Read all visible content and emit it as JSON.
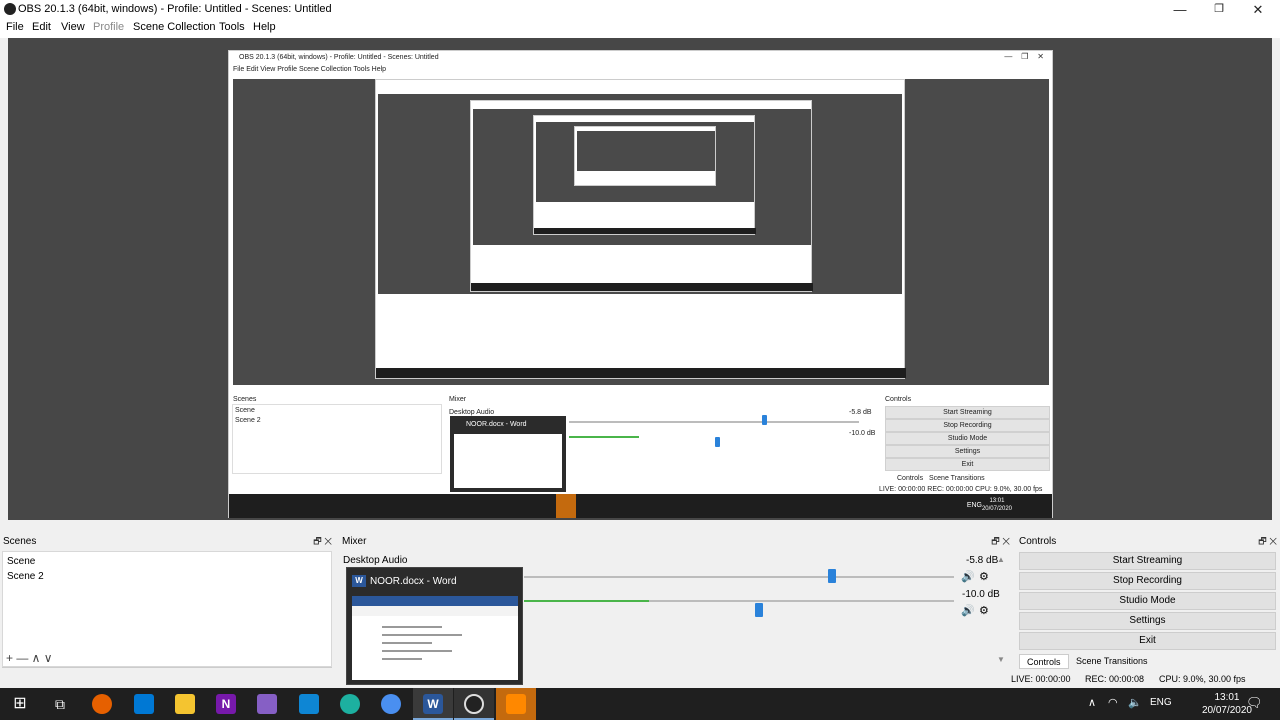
{
  "window": {
    "title": "OBS 20.1.3 (64bit, windows) - Profile: Untitled - Scenes: Untitled",
    "controls": [
      "—",
      "❐",
      "✕"
    ]
  },
  "menu": [
    {
      "label": "File",
      "disabled": false
    },
    {
      "label": "Edit",
      "disabled": false
    },
    {
      "label": "View",
      "disabled": false
    },
    {
      "label": "Profile",
      "disabled": true
    },
    {
      "label": "Scene Collection",
      "disabled": false
    },
    {
      "label": "Tools",
      "disabled": false
    },
    {
      "label": "Help",
      "disabled": false
    }
  ],
  "nested_preview": {
    "title": "OBS 20.1.3 (64bit, windows) - Profile: Untitled - Scenes: Untitled",
    "menu": "File  Edit  View  Profile  Scene Collection  Tools  Help",
    "scenes_header": "Scenes",
    "mixer_header": "Mixer",
    "controls_header": "Controls",
    "scene_1": "Scene",
    "scene_2": "Scene 2",
    "audio_label": "Desktop Audio",
    "db_1": "-5.8 dB",
    "db_2": "-10.0 dB",
    "popup_title": "NOOR.docx - Word",
    "buttons": [
      "Start Streaming",
      "Stop Recording",
      "Studio Mode",
      "Settings",
      "Exit"
    ],
    "tab_controls": "Controls",
    "tab_transitions": "Scene Transitions",
    "status": "LIVE: 00:00:00    REC: 00:00:00    CPU: 9.0%, 30.00 fps",
    "clock_time": "13:01",
    "clock_date": "20/07/2020",
    "lang": "ENG"
  },
  "scenes": {
    "header": "Scenes",
    "items": [
      "Scene",
      "Scene 2"
    ],
    "toolbar": "+  —   ∧  ∨"
  },
  "mixer": {
    "header": "Mixer",
    "track_name": "Desktop Audio",
    "db_top": "-5.8 dB",
    "db_bottom": "-10.0 dB"
  },
  "controls": {
    "header": "Controls",
    "buttons": [
      "Start Streaming",
      "Stop Recording",
      "Studio Mode",
      "Settings",
      "Exit"
    ],
    "tabs": [
      "Controls",
      "Scene Transitions"
    ]
  },
  "status": {
    "live": "LIVE: 00:00:00",
    "rec": "REC: 00:00:08",
    "cpu": "CPU: 9.0%, 30.00 fps"
  },
  "word_popup": {
    "title": "NOOR.docx - Word",
    "icon_letter": "W"
  },
  "taskbar": {
    "time": "13:01",
    "date": "20/07/2020",
    "lang": "ENG",
    "icons": [
      "windows-start-icon",
      "task-view-icon",
      "firefox-icon",
      "mail-icon",
      "file-explorer-icon",
      "onenote-icon",
      "visual-studio-icon",
      "vscode-icon",
      "edge-icon",
      "chrome-icon",
      "word-icon",
      "obs-icon",
      "vlc-icon"
    ]
  },
  "colors": {
    "accent": "#2a82da",
    "preview_bg": "#474747",
    "taskbar": "#1f1f1f",
    "meter": "#4ab54a"
  }
}
